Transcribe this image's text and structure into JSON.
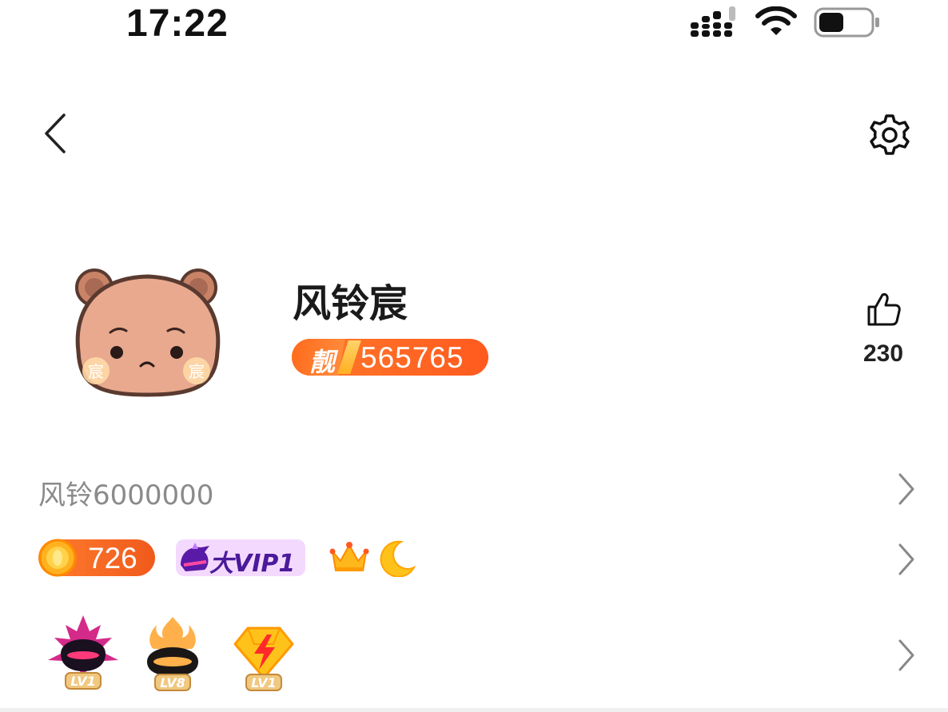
{
  "status_bar": {
    "time": "17:22"
  },
  "profile": {
    "username": "风铃宸",
    "id_badge": {
      "prefix": "靓",
      "number": "565765"
    },
    "likes": "230",
    "avatar_chars": [
      "宸",
      "宸"
    ]
  },
  "rows": {
    "nickname": "风铃6000000",
    "coins": "726",
    "vip_label": "大VIP1",
    "levels": [
      {
        "icon": "dark-bird-level-icon",
        "label": "LV1"
      },
      {
        "icon": "flame-helmet-level-icon",
        "label": "LV8"
      },
      {
        "icon": "lightning-diamond-level-icon",
        "label": "LV1"
      }
    ]
  },
  "colors": {
    "accent_orange": "#ff6a1f",
    "vip_bg": "#f4d9ff",
    "vip_text": "#4a1a9a",
    "avatar_fill": "#e8a98e"
  }
}
